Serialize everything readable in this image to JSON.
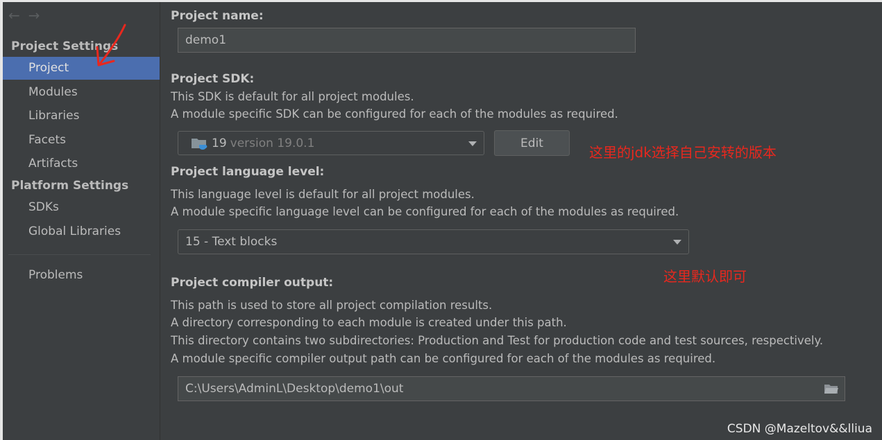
{
  "nav": {
    "back_icon": "arrow-left-icon",
    "forward_icon": "arrow-right-icon"
  },
  "sidebar": {
    "project_settings_title": "Project Settings",
    "project_items": [
      {
        "label": "Project",
        "selected": true
      },
      {
        "label": "Modules",
        "selected": false
      },
      {
        "label": "Libraries",
        "selected": false
      },
      {
        "label": "Facets",
        "selected": false
      },
      {
        "label": "Artifacts",
        "selected": false
      }
    ],
    "platform_settings_title": "Platform Settings",
    "platform_items": [
      {
        "label": "SDKs"
      },
      {
        "label": "Global Libraries"
      }
    ],
    "problems_label": "Problems"
  },
  "main": {
    "project_name": {
      "title": "Project name:",
      "value": "demo1"
    },
    "sdk": {
      "title": "Project SDK:",
      "desc1": "This SDK is default for all project modules.",
      "desc2": "A module specific SDK can be configured for each of the modules as required.",
      "selected_name": "19",
      "selected_version": "version 19.0.1",
      "edit_label": "Edit"
    },
    "language": {
      "title": "Project language level:",
      "desc1": "This language level is default for all project modules.",
      "desc2": "A module specific language level can be configured for each of the modules as required.",
      "selected": "15 - Text blocks"
    },
    "compiler": {
      "title": "Project compiler output:",
      "desc1": "This path is used to store all project compilation results.",
      "desc2": "A directory corresponding to each module is created under this path.",
      "desc3": "This directory contains two subdirectories: Production and Test for production code and test sources, respectively.",
      "desc4": "A module specific compiler output path can be configured for each of the modules as required.",
      "path": "C:\\Users\\AdminL\\Desktop\\demo1\\out"
    }
  },
  "annotations": {
    "sdk_note": "这里的jdk选择自己安转的版本",
    "language_note": "这里默认即可",
    "color": "#e8281e"
  },
  "watermark": "CSDN @Mazeltov&&lliua"
}
